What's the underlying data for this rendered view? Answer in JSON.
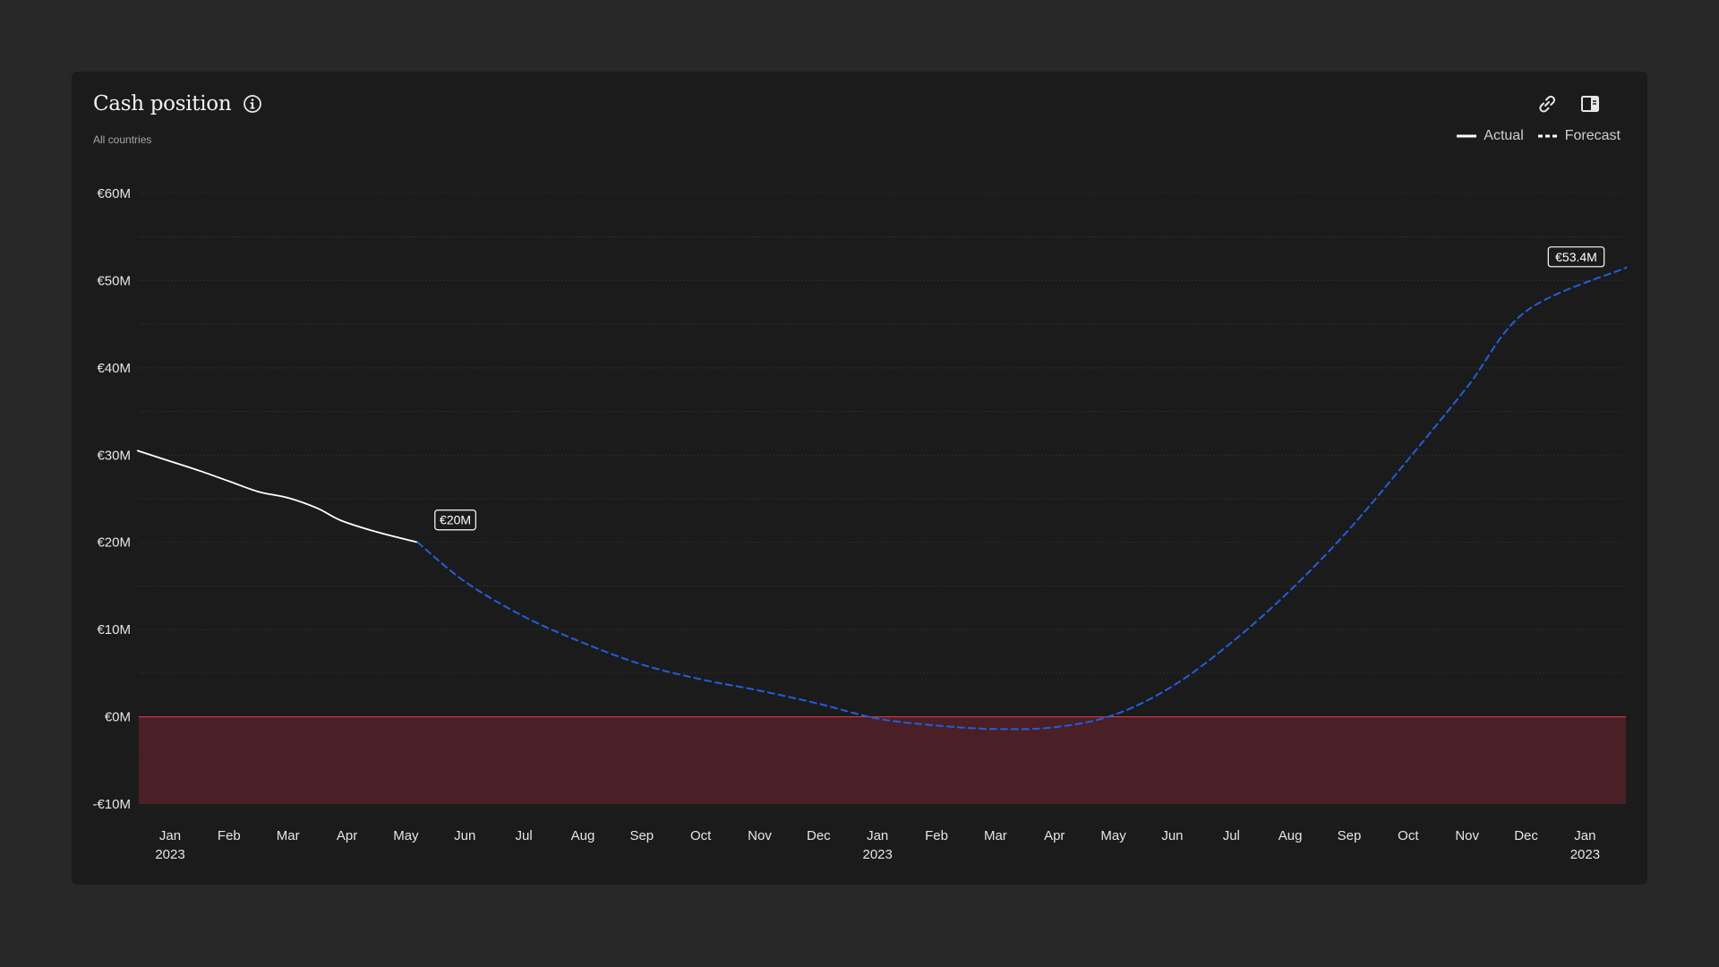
{
  "header": {
    "title": "Cash position",
    "subtitle": "All countries"
  },
  "toolbar": {
    "link_icon": "link-icon",
    "panel_icon": "side-panel-icon"
  },
  "legend": {
    "actual": "Actual",
    "forecast": "Forecast"
  },
  "colors": {
    "actual": "#ffffff",
    "forecast": "#1f5fe0",
    "negative_zone": "#4a1f25",
    "zero_line": "#d23a47"
  },
  "chart_data": {
    "type": "line",
    "title": "Cash position",
    "subtitle": "All countries",
    "xlabel": "",
    "ylabel": "",
    "ylim": [
      -10,
      60
    ],
    "y_ticks": [
      {
        "value": 60,
        "label": "€60M"
      },
      {
        "value": 50,
        "label": "€50M"
      },
      {
        "value": 40,
        "label": "€40M"
      },
      {
        "value": 30,
        "label": "€30M"
      },
      {
        "value": 20,
        "label": "€20M"
      },
      {
        "value": 10,
        "label": "€10M"
      },
      {
        "value": 0,
        "label": "€0M"
      },
      {
        "value": -10,
        "label": "-€10M"
      }
    ],
    "x_ticks": [
      {
        "label": "Jan",
        "year": "2023"
      },
      {
        "label": "Feb",
        "year": ""
      },
      {
        "label": "Mar",
        "year": ""
      },
      {
        "label": "Apr",
        "year": ""
      },
      {
        "label": "May",
        "year": ""
      },
      {
        "label": "Jun",
        "year": ""
      },
      {
        "label": "Jul",
        "year": ""
      },
      {
        "label": "Aug",
        "year": ""
      },
      {
        "label": "Sep",
        "year": ""
      },
      {
        "label": "Oct",
        "year": ""
      },
      {
        "label": "Nov",
        "year": ""
      },
      {
        "label": "Dec",
        "year": ""
      },
      {
        "label": "Jan",
        "year": "2023"
      },
      {
        "label": "Feb",
        "year": ""
      },
      {
        "label": "Mar",
        "year": ""
      },
      {
        "label": "Apr",
        "year": ""
      },
      {
        "label": "May",
        "year": ""
      },
      {
        "label": "Jun",
        "year": ""
      },
      {
        "label": "Jul",
        "year": ""
      },
      {
        "label": "Aug",
        "year": ""
      },
      {
        "label": "Sep",
        "year": ""
      },
      {
        "label": "Oct",
        "year": ""
      },
      {
        "label": "Nov",
        "year": ""
      },
      {
        "label": "Dec",
        "year": ""
      },
      {
        "label": "Jan",
        "year": "2023"
      }
    ],
    "grid": true,
    "legend_position": "top-right",
    "series": [
      {
        "name": "Actual",
        "style": "solid",
        "points": [
          {
            "x": -0.55,
            "y": 30.5
          },
          {
            "x": 0,
            "y": 29.3
          },
          {
            "x": 0.5,
            "y": 28.2
          },
          {
            "x": 1,
            "y": 27.0
          },
          {
            "x": 1.5,
            "y": 25.8
          },
          {
            "x": 2,
            "y": 25.1
          },
          {
            "x": 2.5,
            "y": 23.9
          },
          {
            "x": 2.9,
            "y": 22.5
          },
          {
            "x": 3.5,
            "y": 21.2
          },
          {
            "x": 4.2,
            "y": 20.0
          }
        ]
      },
      {
        "name": "Forecast",
        "style": "dashed",
        "points": [
          {
            "x": 4.2,
            "y": 20.0
          },
          {
            "x": 5,
            "y": 15.5
          },
          {
            "x": 6,
            "y": 11.5
          },
          {
            "x": 7,
            "y": 8.5
          },
          {
            "x": 8,
            "y": 6.0
          },
          {
            "x": 9,
            "y": 4.3
          },
          {
            "x": 10,
            "y": 3.0
          },
          {
            "x": 11,
            "y": 1.5
          },
          {
            "x": 12,
            "y": -0.2
          },
          {
            "x": 13,
            "y": -1.0
          },
          {
            "x": 14,
            "y": -1.4
          },
          {
            "x": 15,
            "y": -1.2
          },
          {
            "x": 16,
            "y": 0.2
          },
          {
            "x": 17,
            "y": 3.5
          },
          {
            "x": 18,
            "y": 8.5
          },
          {
            "x": 19,
            "y": 14.5
          },
          {
            "x": 20,
            "y": 21.5
          },
          {
            "x": 21,
            "y": 29.5
          },
          {
            "x": 22,
            "y": 37.8
          },
          {
            "x": 23,
            "y": 46.5
          },
          {
            "x": 24.7,
            "y": 51.5
          }
        ]
      }
    ],
    "annotations": [
      {
        "text": "€20M",
        "x": 4.2,
        "y": 20.0
      },
      {
        "text": "€53.4M",
        "x": 24.7,
        "y": 51.5
      }
    ],
    "negative_zone": {
      "from": -10,
      "to": 0
    }
  }
}
